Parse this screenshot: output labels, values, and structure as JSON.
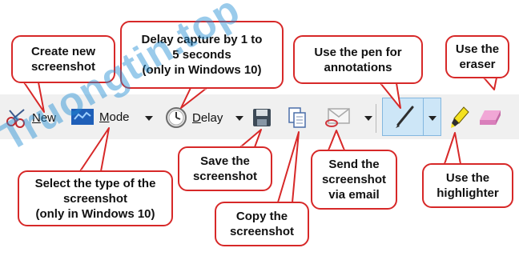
{
  "toolbar": {
    "new_label": "New",
    "new_mnemonic": "N",
    "new_rest": "ew",
    "mode_label": "Mode",
    "mode_mnemonic": "M",
    "mode_rest": "ode",
    "delay_label": "Delay",
    "delay_mnemonic": "D",
    "delay_rest": "elay",
    "icons": [
      "scissors-icon",
      "snip-mode-icon",
      "clock-icon",
      "floppy-disk-icon",
      "copy-icon",
      "email-icon",
      "pen-icon",
      "highlighter-icon",
      "eraser-icon"
    ],
    "pen_selected": true
  },
  "callouts": {
    "create_new": "Create new\nscreenshot",
    "delay": "Delay capture by 1 to\n5 seconds\n(only in Windows 10)",
    "pen": "Use the pen for\nannotations",
    "eraser": "Use the\neraser",
    "select_type": "Select the type of the\nscreenshot\n(only in Windows 10)",
    "save": "Save the\nscreenshot",
    "copy": "Copy the\nscreenshot",
    "send": "Send the\nscreenshot\nvia email",
    "highlighter": "Use the\nhighlighter"
  },
  "watermark": "Truongtin.top",
  "colors": {
    "callout_border": "#d72828",
    "toolbar_bg": "#f0f0f0",
    "selected_bg": "#cde6f7",
    "selected_border": "#83b7df"
  }
}
